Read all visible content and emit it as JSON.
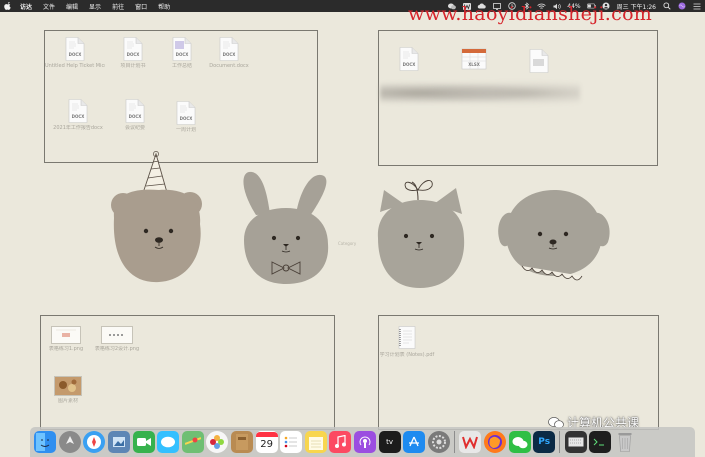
{
  "menubar": {
    "items": [
      "访达",
      "文件",
      "编辑",
      "显示",
      "前往",
      "窗口",
      "帮助"
    ],
    "battery": "44%",
    "clock": "周三 下午1:26",
    "icons": [
      "apple-icon",
      "wechat-status-icon",
      "w-status-icon",
      "cloud-icon",
      "display-icon",
      "clock-icon",
      "bluetooth-icon",
      "wifi-icon",
      "volume-icon",
      "battery-icon",
      "user-icon",
      "search-icon",
      "siri-icon",
      "list-icon"
    ]
  },
  "watermark": {
    "site": "www.haoyidiansheji.com"
  },
  "desktop": {
    "panel1": {
      "files": [
        {
          "badge": "DOCX",
          "label": "Untitled Help Ticket Microso..."
        },
        {
          "badge": "DOCX",
          "label": "项目计划书"
        },
        {
          "badge": "DOCX",
          "label": "工作总结"
        },
        {
          "badge": "DOCX",
          "label": "Document.docx"
        },
        {
          "badge": "DOCX",
          "label": "2021年工作报告docx"
        },
        {
          "badge": "DOCX",
          "label": "会议纪要"
        },
        {
          "badge": "DOCX",
          "label": "一周计划"
        }
      ]
    },
    "panel2": {
      "files": [
        {
          "badge": "DOCX",
          "label": ""
        },
        {
          "badge": "XLSX",
          "label": ""
        },
        {
          "badge": "",
          "label": ""
        }
      ]
    },
    "panel3": {
      "files": [
        {
          "label": "表格练习1.png"
        },
        {
          "label": "表格练习2设计.png"
        },
        {
          "label": "图片素材"
        }
      ]
    },
    "panel4": {
      "files": [
        {
          "label": "学习计划表 (Notes).pdf"
        }
      ]
    },
    "center_label": "Category"
  },
  "dock": {
    "apps": [
      {
        "name": "finder-icon",
        "color": "#2f8ff0"
      },
      {
        "name": "launchpad-icon",
        "color": "#8a8a8a"
      },
      {
        "name": "safari-icon",
        "color": "#3aa0f2"
      },
      {
        "name": "preview-icon",
        "color": "#5d86b5"
      },
      {
        "name": "facetime-icon",
        "color": "#37b24d"
      },
      {
        "name": "messages-icon",
        "color": "#34c0ff"
      },
      {
        "name": "maps-icon",
        "color": "#6fbf73"
      },
      {
        "name": "photos-icon",
        "color": "#f7f7f7"
      },
      {
        "name": "notes-book-icon",
        "color": "#b98b52"
      },
      {
        "name": "calendar-icon",
        "color": "#ffffff",
        "text": "29"
      },
      {
        "name": "reminders-icon",
        "color": "#ffffff"
      },
      {
        "name": "notes-icon",
        "color": "#f8d64e"
      },
      {
        "name": "music-icon",
        "color": "#fc4a62"
      },
      {
        "name": "podcasts-icon",
        "color": "#9b4ee0"
      },
      {
        "name": "appletv-icon",
        "color": "#1c1c1c",
        "text": "tv"
      },
      {
        "name": "appstore-icon",
        "color": "#1e8bf0"
      },
      {
        "name": "system-preferences-icon",
        "color": "#7a7a7a"
      },
      {
        "name": "wps-office-icon",
        "color": "#e8e8e8"
      },
      {
        "name": "firefox-icon",
        "color": "#ff7a1a"
      },
      {
        "name": "wechat-icon",
        "color": "#2fbf45"
      },
      {
        "name": "photoshop-icon",
        "color": "#0b2a45",
        "text": "Ps"
      },
      {
        "name": "keyboard-icon",
        "color": "#333333"
      },
      {
        "name": "terminal-icon",
        "color": "#1e1e1e"
      },
      {
        "name": "trash-icon",
        "color": "#c9c9c9"
      }
    ]
  },
  "wechat_watermark": {
    "text": "计算机公共课"
  }
}
